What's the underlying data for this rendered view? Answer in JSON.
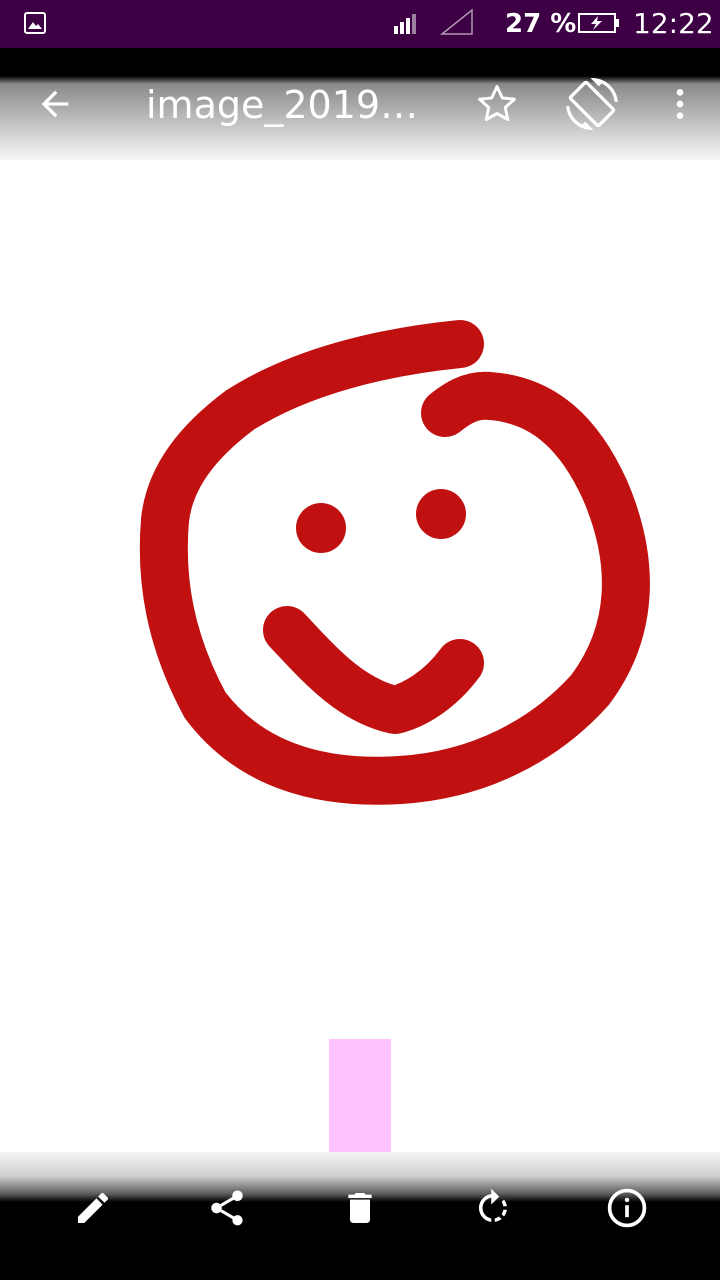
{
  "status_bar": {
    "battery_percent": "27 %",
    "time": "12:22"
  },
  "toolbar": {
    "title": "image_2019-0…",
    "icons": [
      "arrow-left-icon",
      "star-outline-icon",
      "screen-rotation-icon",
      "more-vert-icon"
    ]
  },
  "bottom_bar": {
    "icons": [
      "pencil-icon",
      "share-icon",
      "trash-icon",
      "rotate-icon",
      "info-icon"
    ]
  },
  "colors": {
    "status_bar": "#3d0044",
    "drawing_stroke": "#c01010",
    "scroll_track": "#ffc4ff",
    "icon": "#ffffff"
  }
}
